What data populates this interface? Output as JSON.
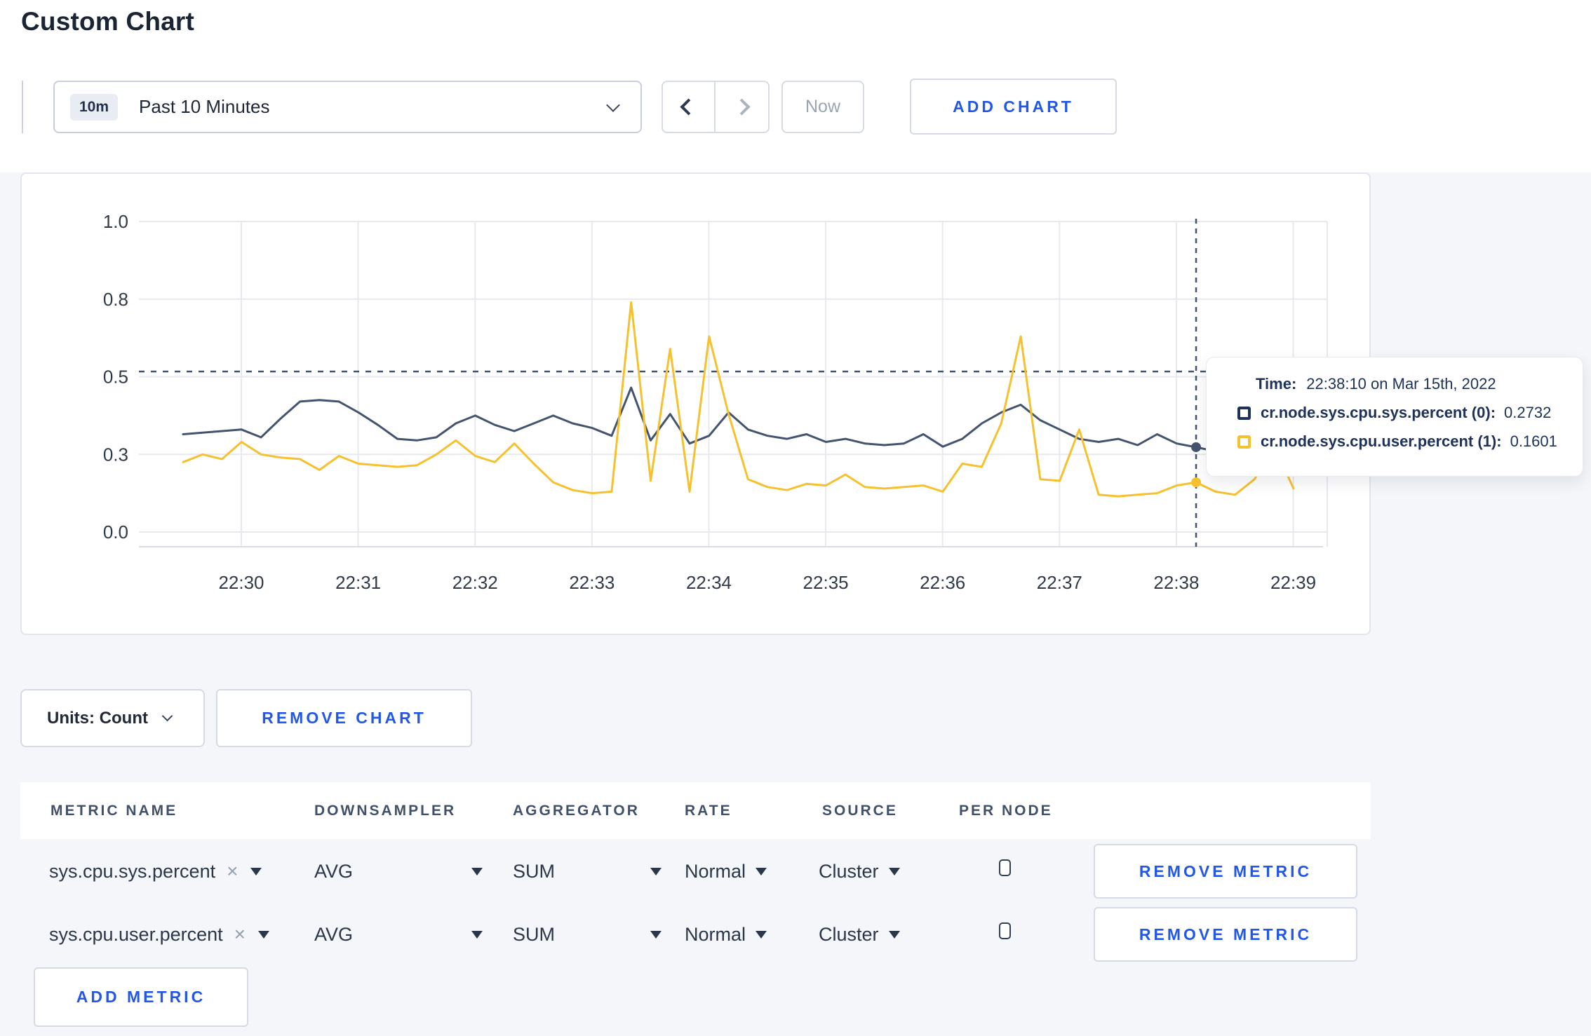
{
  "page": {
    "title": "Custom Chart",
    "background": "#f4f6f9",
    "accent_blue": "#2257e7"
  },
  "toolbar": {
    "range_badge": "10m",
    "range_label": "Past 10 Minutes",
    "now_label": "Now",
    "add_chart_label": "ADD CHART"
  },
  "chart_data": {
    "type": "line",
    "x_start": "22:29:30",
    "x_interval_seconds": 10,
    "x_tick_labels": [
      "22:30",
      "22:31",
      "22:32",
      "22:33",
      "22:34",
      "22:35",
      "22:36",
      "22:37",
      "22:38",
      "22:39"
    ],
    "y_tick_labels": [
      "0.0",
      "0.3",
      "0.5",
      "0.8",
      "1.0"
    ],
    "y_tick_values": [
      0,
      0.25,
      0.5,
      0.75,
      1.0
    ],
    "ylim": [
      0,
      1
    ],
    "grid": true,
    "legend_position": "tooltip",
    "dashed_line_value": 0.517,
    "hover": {
      "index": 52,
      "time": "22:38:10 on Mar 15th, 2022"
    },
    "series": [
      {
        "name": "cr.node.sys.cpu.sys.percent",
        "node": "(0)",
        "color": "#44546f",
        "hover_value": 0.2732,
        "values": [
          0.315,
          0.32,
          0.325,
          0.33,
          0.305,
          0.365,
          0.42,
          0.425,
          0.42,
          0.385,
          0.345,
          0.3,
          0.295,
          0.305,
          0.35,
          0.375,
          0.345,
          0.325,
          0.35,
          0.375,
          0.35,
          0.335,
          0.31,
          0.465,
          0.295,
          0.38,
          0.285,
          0.31,
          0.385,
          0.33,
          0.31,
          0.3,
          0.315,
          0.29,
          0.3,
          0.285,
          0.28,
          0.285,
          0.315,
          0.275,
          0.3,
          0.35,
          0.385,
          0.41,
          0.36,
          0.33,
          0.3,
          0.29,
          0.3,
          0.28,
          0.315,
          0.285,
          0.2732,
          0.26,
          0.26,
          0.27,
          0.29,
          0.3
        ]
      },
      {
        "name": "cr.node.sys.cpu.user.percent",
        "node": "(1)",
        "color": "#f6c12f",
        "hover_value": 0.1601,
        "values": [
          0.225,
          0.25,
          0.235,
          0.29,
          0.25,
          0.24,
          0.235,
          0.2,
          0.245,
          0.22,
          0.215,
          0.21,
          0.215,
          0.25,
          0.295,
          0.245,
          0.225,
          0.285,
          0.22,
          0.16,
          0.135,
          0.125,
          0.13,
          0.74,
          0.165,
          0.59,
          0.13,
          0.63,
          0.38,
          0.17,
          0.145,
          0.135,
          0.155,
          0.15,
          0.185,
          0.145,
          0.14,
          0.145,
          0.15,
          0.13,
          0.22,
          0.21,
          0.35,
          0.63,
          0.17,
          0.165,
          0.33,
          0.12,
          0.115,
          0.12,
          0.125,
          0.15,
          0.1601,
          0.13,
          0.12,
          0.17,
          0.28,
          0.14
        ]
      }
    ]
  },
  "tooltip": {
    "time_label": "Time:",
    "time_value": "22:38:10 on Mar 15th, 2022",
    "rows": [
      {
        "label": "cr.node.sys.cpu.sys.percent (0):",
        "value": "0.2732"
      },
      {
        "label": "cr.node.sys.cpu.user.percent (1):",
        "value": "0.1601"
      }
    ]
  },
  "units_row": {
    "units_label": "Units: Count",
    "remove_chart_label": "REMOVE CHART"
  },
  "metrics_table": {
    "headers": [
      "METRIC NAME",
      "DOWNSAMPLER",
      "AGGREGATOR",
      "RATE",
      "SOURCE",
      "PER NODE"
    ],
    "rows": [
      {
        "metric": "sys.cpu.sys.percent",
        "close_glyph": "×",
        "downsampler": "AVG",
        "aggregator": "SUM",
        "rate": "Normal",
        "source": "Cluster",
        "per_node_checked": false,
        "remove_label": "REMOVE METRIC"
      },
      {
        "metric": "sys.cpu.user.percent",
        "close_glyph": "×",
        "downsampler": "AVG",
        "aggregator": "SUM",
        "rate": "Normal",
        "source": "Cluster",
        "per_node_checked": false,
        "remove_label": "REMOVE METRIC"
      }
    ],
    "add_metric_label": "ADD METRIC"
  }
}
